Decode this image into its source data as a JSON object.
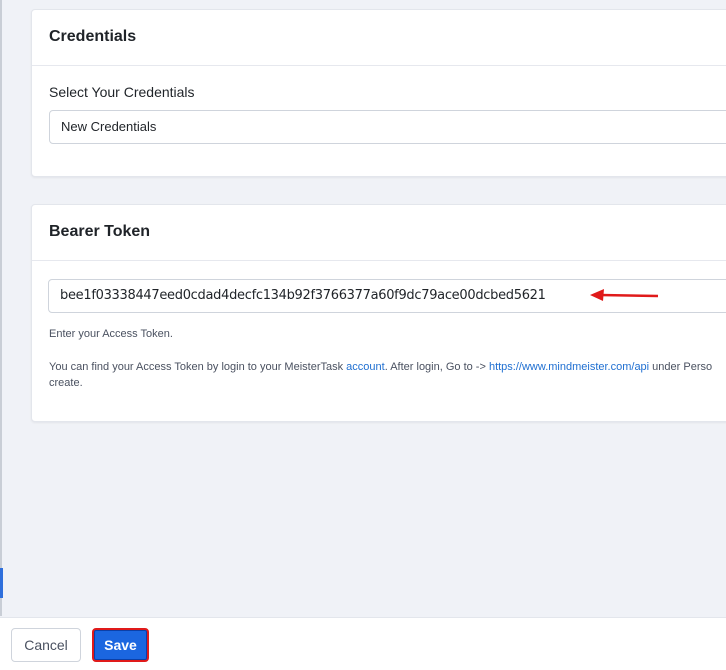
{
  "credentials": {
    "title": "Credentials",
    "select_label": "Select Your Credentials",
    "selected_value": "New Credentials"
  },
  "token": {
    "title": "Bearer Token",
    "value": "bee1f03338447eed0cdad4decfc134b92f3766377a60f9dc79ace00dcbed5621",
    "hint": "Enter your Access Token.",
    "info_prefix": "You can find your Access Token by login to your MeisterTask ",
    "info_link_account": "account",
    "info_middle": ". After login, Go to -> ",
    "info_link_url": "https://www.mindmeister.com/api",
    "info_suffix": " under Perso",
    "info_line2": "create.",
    "annotation_arrow_color": "#e01a1a"
  },
  "footer": {
    "cancel_label": "Cancel",
    "save_label": "Save"
  },
  "colors": {
    "accent": "#1b66e0",
    "link": "#1f6fd1",
    "highlight": "#e01a1a"
  }
}
